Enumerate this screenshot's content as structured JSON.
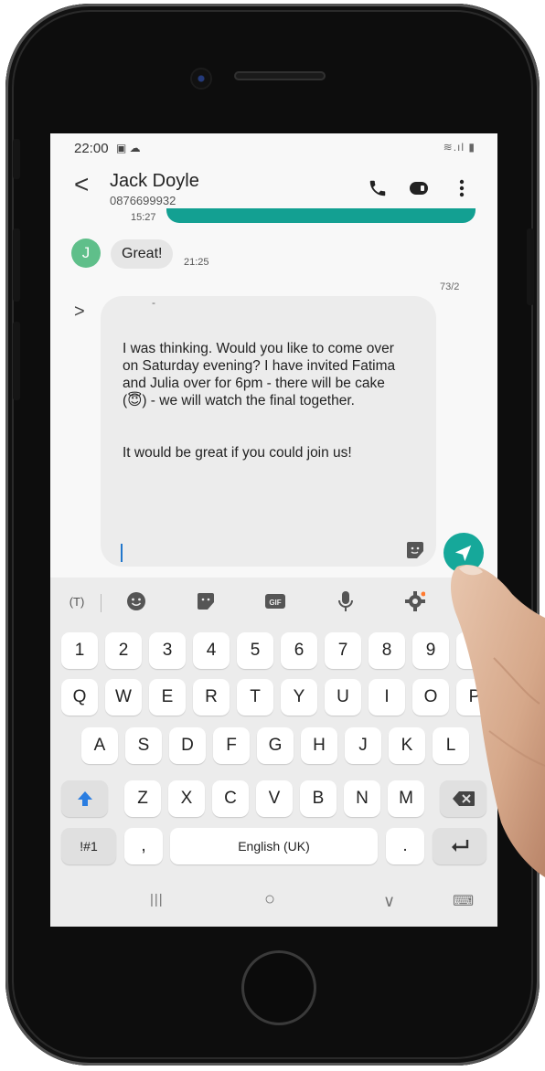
{
  "status": {
    "time": "22:00",
    "left_icons": "▣ ☁",
    "right_icons": "≋.ıl ▮"
  },
  "header": {
    "back": "<",
    "name": "Jack Doyle",
    "number": "0876699932"
  },
  "thread": {
    "prev_time": "15:27",
    "avatar_initial": "J",
    "received_text": "Great!",
    "received_time": "21:25"
  },
  "compose": {
    "counter": "73/2",
    "expand": ">",
    "top_mark": "-",
    "text": "I was thinking. Would you like to come over on Saturday evening? I have invited Fatima and Julia over for 6pm - there will be cake (😇) - we will watch the final together.\n\n\nIt would be great if you could join us!"
  },
  "keyboard": {
    "tools": {
      "translate": "(T)",
      "more": "..."
    },
    "row_numbers": [
      "1",
      "2",
      "3",
      "4",
      "5",
      "6",
      "7",
      "8",
      "9",
      "0"
    ],
    "row_q": [
      "Q",
      "W",
      "E",
      "R",
      "T",
      "Y",
      "U",
      "I",
      "O",
      "P"
    ],
    "row_a": [
      "A",
      "S",
      "D",
      "F",
      "G",
      "H",
      "J",
      "K",
      "L"
    ],
    "row_z": [
      "Z",
      "X",
      "C",
      "V",
      "B",
      "N",
      "M"
    ],
    "symbols": "!#1",
    "comma": ",",
    "space": "English (UK)",
    "period": "."
  },
  "navbar": {
    "recent": "|||",
    "home": "○",
    "back": "∨",
    "keyboard": "⌨"
  },
  "colors": {
    "accent": "#16a89a",
    "shift": "#2a7de1"
  }
}
